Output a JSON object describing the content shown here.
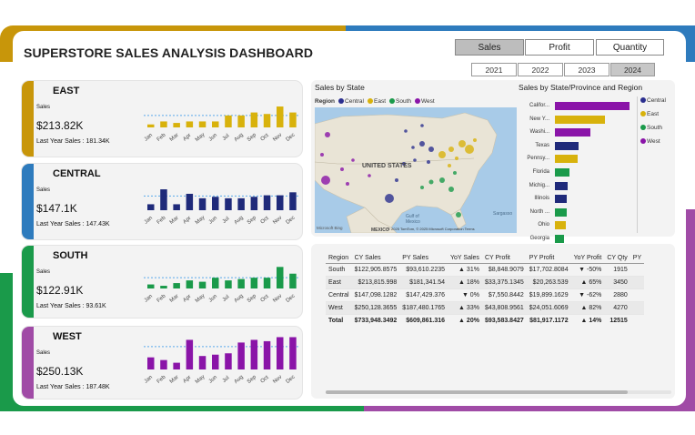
{
  "title": "SUPERSTORE SALES ANALYSIS DASHBOARD",
  "metric_tabs": [
    {
      "label": "Sales",
      "selected": true
    },
    {
      "label": "Profit",
      "selected": false
    },
    {
      "label": "Quantity",
      "selected": false
    }
  ],
  "years": [
    {
      "label": "2021",
      "selected": false
    },
    {
      "label": "2022",
      "selected": false
    },
    {
      "label": "2023",
      "selected": false
    },
    {
      "label": "2024",
      "selected": true
    }
  ],
  "months": [
    "Jan",
    "Feb",
    "Mar",
    "Apr",
    "May",
    "Jun",
    "Jul",
    "Aug",
    "Sep",
    "Oct",
    "Nov",
    "Dec"
  ],
  "regions": [
    {
      "name": "EAST",
      "sales_label": "Sales",
      "sales": "$213.82K",
      "last_year": "Last Year Sales : 181.34K",
      "color": "#d8b20c",
      "stripe": "#c8960a",
      "values": [
        2,
        4,
        3,
        4,
        4,
        4,
        8,
        8,
        10,
        9,
        14,
        10
      ],
      "avg": 8
    },
    {
      "name": "CENTRAL",
      "sales_label": "Sales",
      "sales": "$147.1K",
      "last_year": "Last Year Sales : 147.43K",
      "color": "#1f2a7a",
      "stripe": "#2e7bbd",
      "values": [
        4,
        14,
        4,
        11,
        8,
        9,
        8,
        8,
        9,
        10,
        10,
        12
      ],
      "avg": 9.5
    },
    {
      "name": "SOUTH",
      "sales_label": "Sales",
      "sales": "$122.91K",
      "last_year": "Last Year Sales : 93.61K",
      "color": "#1a9a4a",
      "stripe": "#1a9a4a",
      "values": [
        3,
        2,
        4,
        6,
        5,
        8,
        6,
        7,
        8,
        8,
        16,
        11
      ],
      "avg": 8
    },
    {
      "name": "WEST",
      "sales_label": "Sales",
      "sales": "$250.13K",
      "last_year": "Last Year Sales : 187.48K",
      "color": "#8a14a8",
      "stripe": "#a04ba6",
      "values": [
        9,
        7,
        5,
        22,
        10,
        11,
        12,
        20,
        22,
        21,
        24,
        24
      ],
      "avg": 17
    }
  ],
  "map": {
    "title": "Sales by State",
    "legend_title": "Region",
    "legend": [
      {
        "name": "Central",
        "color": "#2b2f8f"
      },
      {
        "name": "East",
        "color": "#d8b20c"
      },
      {
        "name": "South",
        "color": "#1a9a4a"
      },
      {
        "name": "West",
        "color": "#8a14a8"
      }
    ],
    "country_label": "UNITED STATES",
    "gulf_label": "Gulf of Mexico",
    "mexico_label": "MEXICO",
    "sargasso_label": "Sargasso",
    "attribution": "© 2025 TomTom, © 2025 Microsoft Corporation  Terms",
    "brand": "Microsoft Bing"
  },
  "state_bars": {
    "title": "Sales by State/Province and Region",
    "bars": [
      {
        "label": "Califor...",
        "value": 82,
        "color": "#8a14a8"
      },
      {
        "label": "New Y...",
        "value": 55,
        "color": "#d8b20c"
      },
      {
        "label": "Washi...",
        "value": 39,
        "color": "#8a14a8"
      },
      {
        "label": "Texas",
        "value": 26,
        "color": "#1f2a7a"
      },
      {
        "label": "Pennsy...",
        "value": 25,
        "color": "#d8b20c"
      },
      {
        "label": "Florida",
        "value": 16,
        "color": "#1a9a4a"
      },
      {
        "label": "Michig...",
        "value": 14,
        "color": "#1f2a7a"
      },
      {
        "label": "Illinois",
        "value": 13,
        "color": "#1f2a7a"
      },
      {
        "label": "North ...",
        "value": 13,
        "color": "#1a9a4a"
      },
      {
        "label": "Ohio",
        "value": 12,
        "color": "#d8b20c"
      },
      {
        "label": "Georgia",
        "value": 10,
        "color": "#1a9a4a"
      }
    ],
    "legend": [
      {
        "name": "Central",
        "color": "#2b2f8f"
      },
      {
        "name": "East",
        "color": "#d8b20c"
      },
      {
        "name": "South",
        "color": "#1a9a4a"
      },
      {
        "name": "West",
        "color": "#8a14a8"
      }
    ]
  },
  "table": {
    "headers": [
      "Region",
      "CY Sales",
      "PY Sales",
      "YoY Sales",
      "CY Profit",
      "PY Profit",
      "YoY Profit",
      "CY Qty",
      "PY"
    ],
    "rows": [
      [
        "South",
        "$122,905.8575",
        "$93,610.2235",
        "▲ 31%",
        "$8,848.9079",
        "$17,702.8084",
        "▼ -50%",
        "1915",
        ""
      ],
      [
        "East",
        "$213,815.998",
        "$181,341.54",
        "▲ 18%",
        "$33,375.1345",
        "$20,263.539",
        "▲ 65%",
        "3450",
        ""
      ],
      [
        "Central",
        "$147,098.1282",
        "$147,429.376",
        "▼ 0%",
        "$7,550.8442",
        "$19,899.1629",
        "▼ -62%",
        "2880",
        ""
      ],
      [
        "West",
        "$250,128.3655",
        "$187,480.1765",
        "▲ 33%",
        "$43,808.9561",
        "$24,051.6069",
        "▲ 82%",
        "4270",
        ""
      ]
    ],
    "total": [
      "Total",
      "$733,948.3492",
      "$609,861.316",
      "▲ 20%",
      "$93,583.8427",
      "$81,917.1172",
      "▲ 14%",
      "12515",
      ""
    ]
  }
}
